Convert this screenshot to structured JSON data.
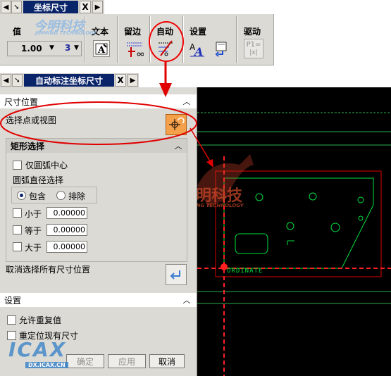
{
  "toolbar": {
    "tab_title": "坐标尺寸",
    "close_label": "X",
    "groups": {
      "value_label": "值",
      "value_number": "1.00",
      "precision": "3",
      "text_label": "文本",
      "leader_label": "留边",
      "auto_label": "自动",
      "settings_label": "设置",
      "drive_label": "驱动",
      "drive_icon_text": "P1=",
      "drive_icon_text2": "|x|"
    }
  },
  "dialog": {
    "tab_title": "自动标注坐标尺寸",
    "close_label": "X",
    "dim_position": {
      "header": "尺寸位置",
      "select_prompt": "选择点或视图",
      "rect_select": {
        "header": "矩形选择",
        "arc_center_only": "仅圆弧中心",
        "arc_diameter_label": "圆弧直径选择",
        "include_label": "包含",
        "exclude_label": "排除",
        "selected_mode": "包含",
        "less_than_label": "小于",
        "less_than_value": "0.00000",
        "equal_label": "等于",
        "equal_value": "0.00000",
        "greater_than_label": "大于",
        "greater_than_value": "0.00000"
      },
      "deselect_all": "取消选择所有尺寸位置"
    },
    "settings": {
      "header": "设置",
      "allow_duplicates": "允许重复值",
      "reposition_existing": "重定位现有尺寸"
    },
    "buttons": {
      "ok": "确定",
      "apply": "应用",
      "cancel": "取消"
    }
  },
  "graphics": {
    "ordinate_label": "ORDINATE"
  },
  "watermarks": {
    "logo_cn": "今明科技",
    "logo_en": "JINMING TECHNOLOGY",
    "icax_text": "ICAX",
    "icax_url": "DX.ICAX.CN"
  },
  "colors": {
    "title_bar": "#0a246a",
    "panel_bg": "#dcdad5",
    "annotation_red": "#e00000",
    "geometry_green": "#00ff40",
    "dashed_red": "#ff2020"
  }
}
